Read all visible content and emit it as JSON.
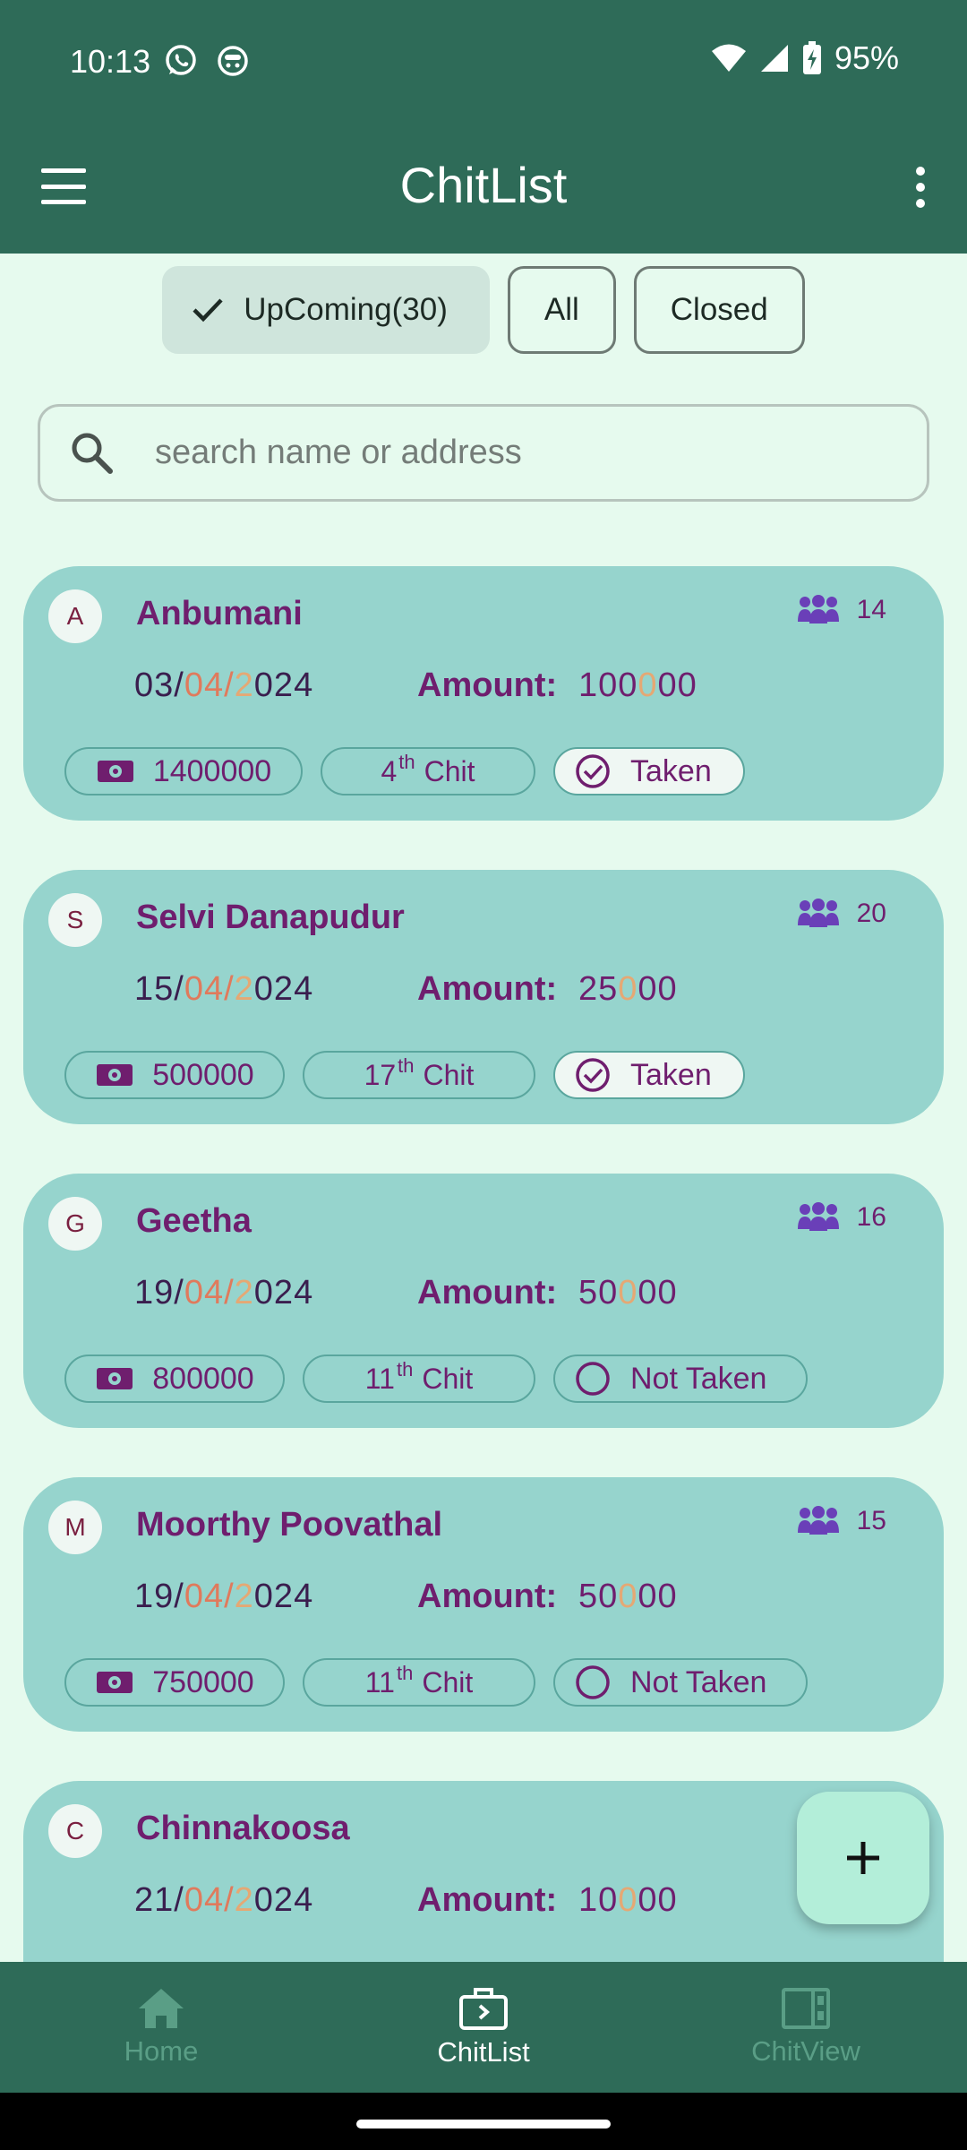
{
  "status_bar": {
    "time": "10:13",
    "battery": "95%"
  },
  "app_bar": {
    "title": "ChitList"
  },
  "filters": {
    "upcoming": "UpComing(30)",
    "all": "All",
    "closed": "Closed"
  },
  "search": {
    "placeholder": "search name or address"
  },
  "amount_label": "Amount:",
  "cards": [
    {
      "initial": "A",
      "name": "Anbumani",
      "members": "14",
      "date_day": "03/",
      "date_month": "04/",
      "date_mid": "2",
      "date_end": "024",
      "amount_a": "100",
      "amount_h": "0",
      "amount_b": "00",
      "total": "1400000",
      "chit_num": "4",
      "chit_sup": "th",
      "chit_text": "Chit",
      "status": "Taken"
    },
    {
      "initial": "S",
      "name": "Selvi Danapudur",
      "members": "20",
      "date_day": "15/",
      "date_month": "04/",
      "date_mid": "2",
      "date_end": "024",
      "amount_a": "25",
      "amount_h": "0",
      "amount_b": "00",
      "total": "500000",
      "chit_num": "17",
      "chit_sup": "th",
      "chit_text": "Chit",
      "status": "Taken"
    },
    {
      "initial": "G",
      "name": "Geetha",
      "members": "16",
      "date_day": "19/",
      "date_month": "04/",
      "date_mid": "2",
      "date_end": "024",
      "amount_a": "50",
      "amount_h": "0",
      "amount_b": "00",
      "total": "800000",
      "chit_num": "11",
      "chit_sup": "th",
      "chit_text": "Chit",
      "status": "Not Taken"
    },
    {
      "initial": "M",
      "name": "Moorthy Poovathal",
      "members": "15",
      "date_day": "19/",
      "date_month": "04/",
      "date_mid": "2",
      "date_end": "024",
      "amount_a": "50",
      "amount_h": "0",
      "amount_b": "00",
      "total": "750000",
      "chit_num": "11",
      "chit_sup": "th",
      "chit_text": "Chit",
      "status": "Not Taken"
    },
    {
      "initial": "C",
      "name": "Chinnakoosa",
      "date_day": "21/",
      "date_month": "04/",
      "date_mid": "2",
      "date_end": "024",
      "amount_a": "10",
      "amount_h": "0",
      "amount_b": "00"
    }
  ],
  "bottom_nav": {
    "home": "Home",
    "chitlist": "ChitList",
    "chitview": "ChitView"
  },
  "colors": {
    "primary": "#2E6B58",
    "card": "#96D4CD",
    "accent_text": "#6F1E6E",
    "background": "#E6FAEE"
  }
}
